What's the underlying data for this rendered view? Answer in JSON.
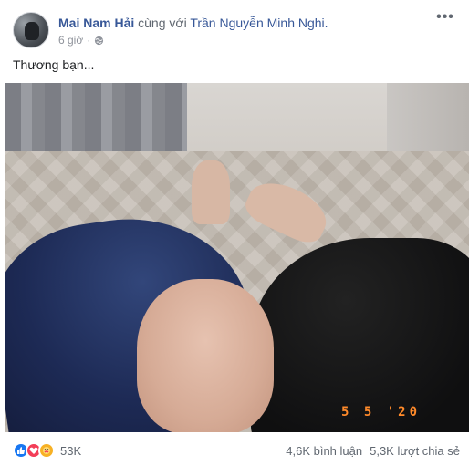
{
  "post": {
    "author": "Mai Nam Hải",
    "with_text": "cùng với",
    "tagged": "Trần Nguyễn Minh Nghi.",
    "time": "6 giờ",
    "separator": "·",
    "more_label": "•••",
    "caption": "Thương bạn...",
    "photo_date_stamp": "5 5 '20"
  },
  "reactions": {
    "icons": [
      "like-icon",
      "love-icon",
      "care-icon"
    ],
    "count": "53K"
  },
  "stats": {
    "comments": "4,6K bình luận",
    "shares": "5,3K lượt chia sẻ"
  },
  "colors": {
    "link": "#385898",
    "meta": "#90949c",
    "like": "#1877f2",
    "love": "#f33e58",
    "care": "#f7b125",
    "date_stamp": "#ff8a2a"
  }
}
